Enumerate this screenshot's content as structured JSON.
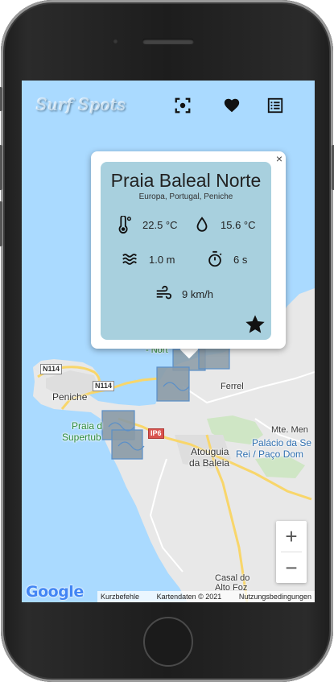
{
  "app": {
    "title": "Surf Spots",
    "icons": [
      "locate-icon",
      "favorites-heart-icon",
      "list-icon"
    ]
  },
  "popup": {
    "close_label": "×",
    "spot_name": "Praia Baleal Norte",
    "region": "Europa, Portugal, Peniche",
    "air_temperature": "22.5 °C",
    "water_temperature": "15.6 °C",
    "wave_height": "1.0 m",
    "wave_period": "6 s",
    "wind_speed": "9 km/h"
  },
  "map": {
    "labels": {
      "peniche": "Peniche",
      "praia_supertubos_1": "Praia d",
      "praia_supertubos_2": "Supertub",
      "ferrel": "Ferrel",
      "atouguia_1": "Atouguia",
      "atouguia_2": "da Baleia",
      "mte_men": "Mte. Men",
      "palacio_1": "Palácio da Se",
      "palacio_2": "Rei / Paço Dom",
      "casal_1": "Casal do",
      "casal_2": "Alto Foz",
      "nort": "- Nort",
      "n114_a": "N114",
      "n114_b": "N114",
      "ip6": "IP6"
    },
    "zoom_in": "+",
    "zoom_out": "−",
    "logo": "Google",
    "attribution": {
      "shortcuts": "Kurzbefehle",
      "map_data": "Kartendaten © 2021",
      "terms": "Nutzungsbedingungen"
    }
  },
  "colors": {
    "water": "#aadaff",
    "land": "#e8e8e8",
    "card": "#a8d0de",
    "highway": "#f8d66b"
  }
}
